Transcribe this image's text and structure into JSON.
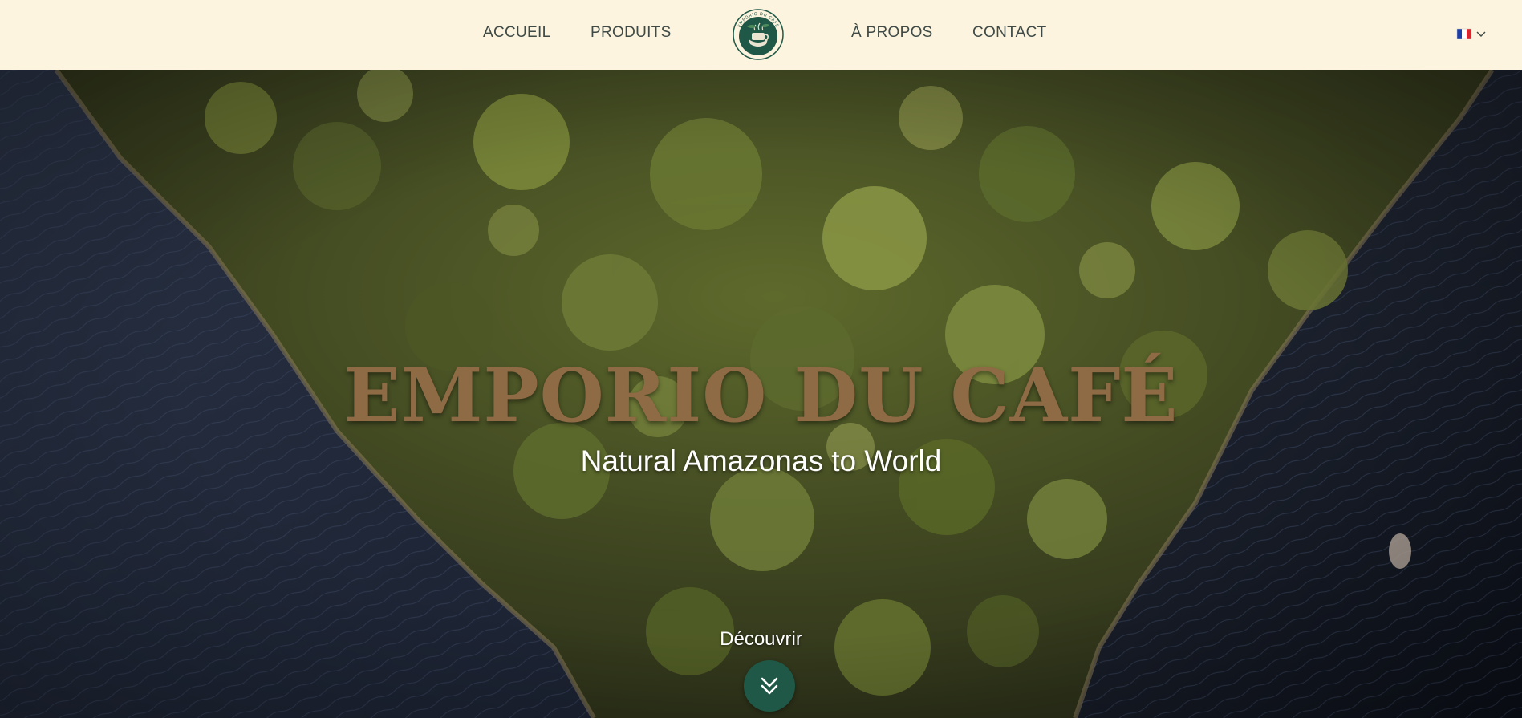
{
  "nav": {
    "links": [
      {
        "label": "ACCUEIL"
      },
      {
        "label": "PRODUITS"
      },
      {
        "label": "À PROPOS"
      },
      {
        "label": "CONTACT"
      }
    ],
    "logo_icon": "coffee-cup-emblem-icon",
    "logo_ring_text": "EMPORIO DU CAFÉ",
    "language": {
      "icon": "french-flag-icon",
      "dropdown_icon": "chevron-down-icon"
    }
  },
  "hero": {
    "title": "EMPORIO DU CAFÉ",
    "subtitle": "Natural Amazonas to World",
    "discover_label": "Découvrir",
    "discover_icon": "double-chevron-down-icon"
  },
  "colors": {
    "header_bg": "#fcf4de",
    "nav_text": "#3f4a46",
    "brand_green": "#1f5846",
    "title_brown": "#8e6a45"
  }
}
